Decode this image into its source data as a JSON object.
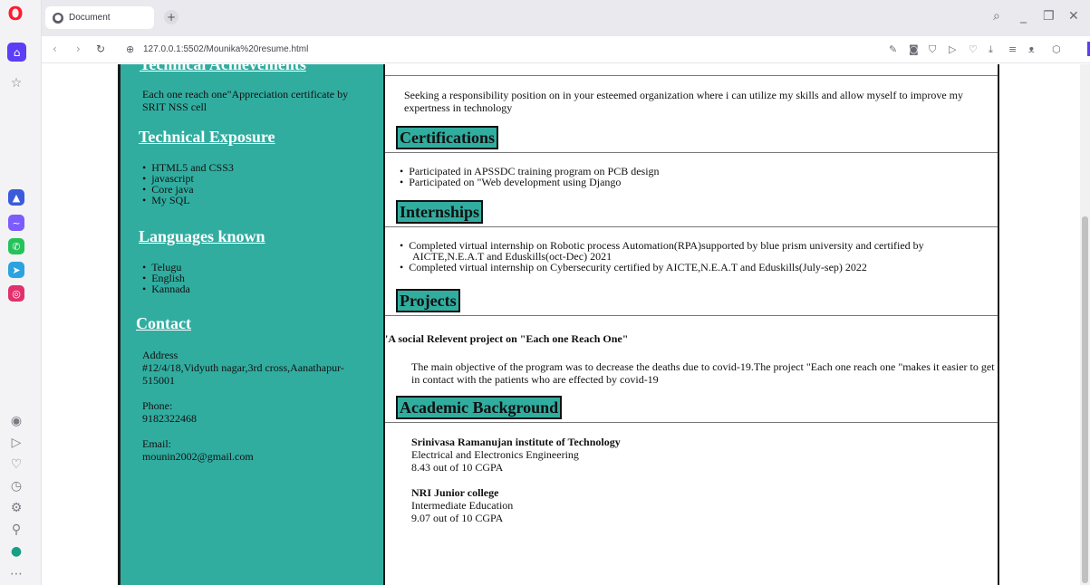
{
  "browser": {
    "tab_title": "Document",
    "url": "127.0.0.1:5502/Mounika%20resume.html",
    "new_tab_glyph": "+",
    "logo_glyph": "O"
  },
  "left": {
    "clipped_heading": "Technical Achievements",
    "achievement": "Each one reach one\"Appreciation certificate by SRIT NSS cell",
    "technical_exposure": {
      "heading": "Technical Exposure",
      "items": [
        "HTML5 and CSS3",
        "javascript",
        "Core java",
        "My SQL"
      ]
    },
    "languages": {
      "heading": "Languages known",
      "items": [
        "Telugu",
        "English",
        "Kannada"
      ]
    },
    "contact": {
      "heading": "Contact",
      "address_label": "Address",
      "address_value": "#12/4/18,Vidyuth nagar,3rd cross,Aanathapur-515001",
      "phone_label": "Phone:",
      "phone_value": "9182322468",
      "email_label": "Email:",
      "email_value": "mounin2002@gmail.com"
    }
  },
  "right": {
    "objective": "Seeking a responsibility position on in your esteemed organization where i can utilize my skills and allow myself to improve my expertness in technology",
    "certifications": {
      "heading": "Certifications",
      "items": [
        "Participated in APSSDC training program on PCB design",
        "Participated on \"Web development using Django"
      ]
    },
    "internships": {
      "heading": "Internships",
      "items": [
        "Completed virtual internship on Robotic process Automation(RPA)supported by blue prism university and certified by AICTE,N.E.A.T and Eduskills(oct-Dec) 2021",
        "Completed virtual internship on Cybersecurity certified by AICTE,N.E.A.T and Eduskills(July-sep) 2022"
      ]
    },
    "projects": {
      "heading": "Projects",
      "title": "'A social Relevent project on \"Each one Reach One\"",
      "description": "The main objective of the program was to decrease the deaths due to covid-19.The project \"Each one reach one \"makes it easier to get in contact with the patients who are effected by covid-19"
    },
    "academic": {
      "heading": "Academic Background",
      "entries": [
        {
          "institution": "Srinivasa Ramanujan institute of Technology",
          "course": "Electrical and Electronics Engineering",
          "score": "8.43 out of 10 CGPA"
        },
        {
          "institution": "NRI Junior college",
          "course": "Intermediate Education",
          "score": "9.07 out of 10 CGPA"
        }
      ]
    }
  },
  "icons": {
    "sidebar": [
      "home-icon",
      "bookmark-star-icon",
      "aria-icon",
      "messenger-icon",
      "whatsapp-icon",
      "telegram-icon",
      "instagram-icon",
      "player-icon",
      "send-icon",
      "heart-icon",
      "history-icon",
      "settings-icon",
      "pinboard-icon",
      "ai-icon",
      "more-icon"
    ]
  }
}
